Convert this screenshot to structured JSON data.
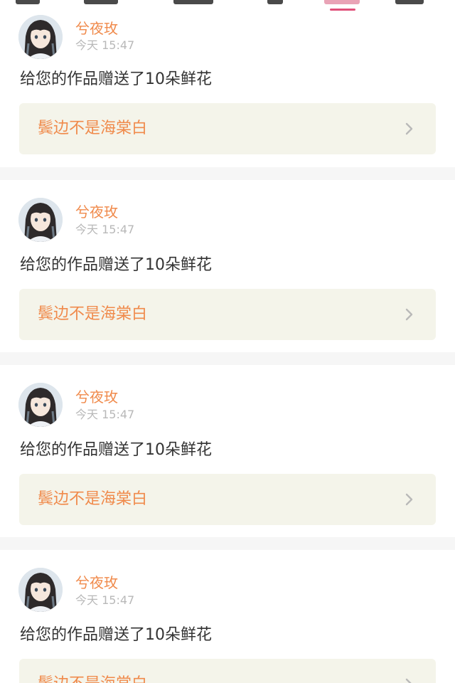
{
  "notifications": [
    {
      "user_name": "兮夜玫",
      "time": "今天 15:47",
      "message": "给您的作品赠送了10朵鲜花",
      "work_title": "鬓边不是海棠白",
      "avatar_icon": "girl-avatar",
      "chevron_icon": "chevron-right-icon"
    },
    {
      "user_name": "兮夜玫",
      "time": "今天 15:47",
      "message": "给您的作品赠送了10朵鲜花",
      "work_title": "鬓边不是海棠白",
      "avatar_icon": "girl-avatar",
      "chevron_icon": "chevron-right-icon"
    },
    {
      "user_name": "兮夜玫",
      "time": "今天 15:47",
      "message": "给您的作品赠送了10朵鲜花",
      "work_title": "鬓边不是海棠白",
      "avatar_icon": "girl-avatar",
      "chevron_icon": "chevron-right-icon"
    },
    {
      "user_name": "兮夜玫",
      "time": "今天 15:47",
      "message": "给您的作品赠送了10朵鲜花",
      "work_title": "鬓边不是海棠白",
      "avatar_icon": "girl-avatar",
      "chevron_icon": "chevron-right-icon"
    }
  ],
  "colors": {
    "accent_orange": "#f08a4b",
    "tab_indicator_pink": "#e0507a",
    "link_background": "#f4f4ea",
    "separator_gray": "#f6f6f6"
  }
}
